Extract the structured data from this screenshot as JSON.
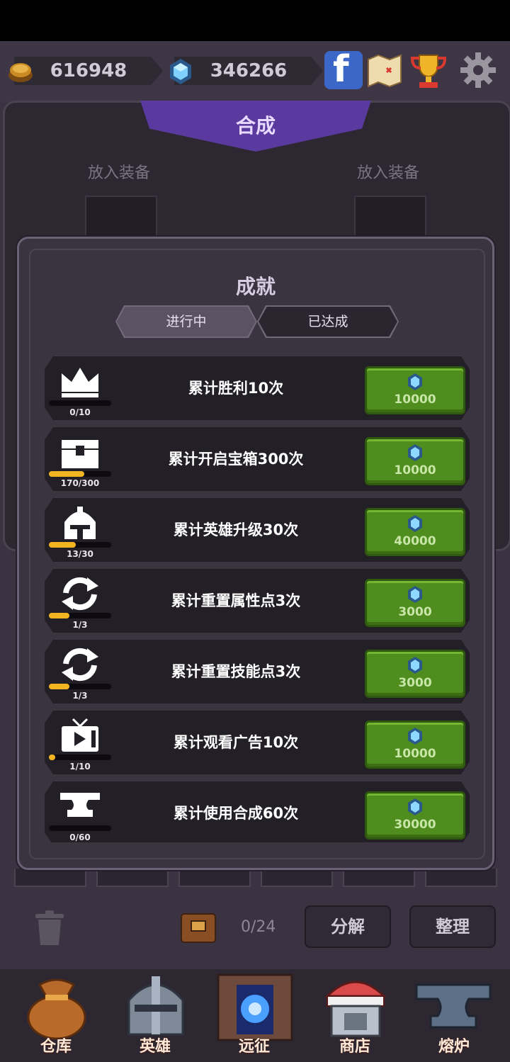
{
  "resources": {
    "coins": "616948",
    "gems": "346266"
  },
  "top_buttons": {
    "facebook_glyph": "f"
  },
  "merge": {
    "title": "合成",
    "slot_left": "放入装备",
    "slot_right": "放入装备"
  },
  "dialog": {
    "title": "成就",
    "tabs": [
      {
        "label": "进行中",
        "active": true
      },
      {
        "label": "已达成",
        "active": false
      }
    ],
    "achievements": [
      {
        "icon": "crown-icon",
        "title": "累计胜利10次",
        "progress_text": "0/10",
        "progress": 0.0,
        "reward": "10000"
      },
      {
        "icon": "chest-icon",
        "title": "累计开启宝箱300次",
        "progress_text": "170/300",
        "progress": 0.567,
        "reward": "10000"
      },
      {
        "icon": "helmet-icon",
        "title": "累计英雄升级30次",
        "progress_text": "13/30",
        "progress": 0.433,
        "reward": "40000"
      },
      {
        "icon": "refresh-icon",
        "title": "累计重置属性点3次",
        "progress_text": "1/3",
        "progress": 0.333,
        "reward": "3000"
      },
      {
        "icon": "refresh-icon",
        "title": "累计重置技能点3次",
        "progress_text": "1/3",
        "progress": 0.333,
        "reward": "3000"
      },
      {
        "icon": "tv-icon",
        "title": "累计观看广告10次",
        "progress_text": "1/10",
        "progress": 0.1,
        "reward": "10000"
      },
      {
        "icon": "anvil-icon",
        "title": "累计使用合成60次",
        "progress_text": "0/60",
        "progress": 0.0,
        "reward": "30000"
      }
    ]
  },
  "inventory": {
    "count": "0/24",
    "decompose_label": "分解",
    "sort_label": "整理"
  },
  "nav": [
    {
      "label": "仓库",
      "icon": "bag-icon"
    },
    {
      "label": "英雄",
      "icon": "helmet-icon"
    },
    {
      "label": "远征",
      "icon": "portal-icon"
    },
    {
      "label": "商店",
      "icon": "shop-icon"
    },
    {
      "label": "熔炉",
      "icon": "anvil-icon"
    }
  ],
  "colors": {
    "accent_purple": "#5a3a9e",
    "reward_green": "#4e8d1e",
    "progress_yellow": "#f2b420"
  }
}
